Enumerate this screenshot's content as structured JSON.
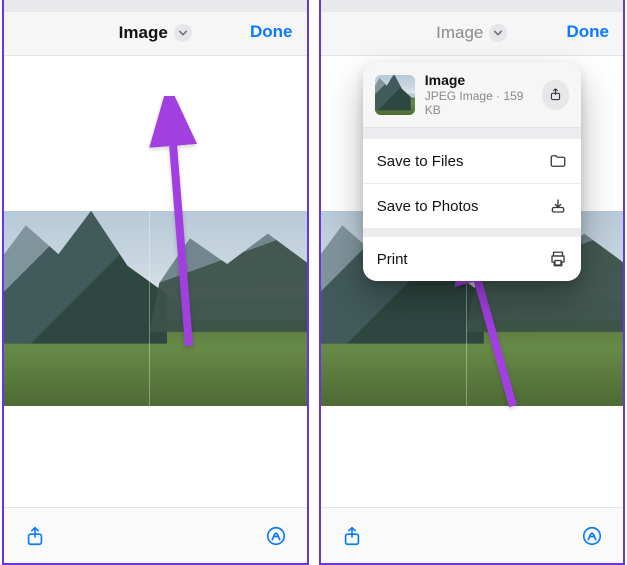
{
  "colors": {
    "accent": "#0a7aff",
    "annotation": "#a23fe0"
  },
  "left": {
    "header": {
      "title": "Image",
      "done_label": "Done"
    }
  },
  "right": {
    "header": {
      "title": "Image",
      "done_label": "Done"
    },
    "menu": {
      "file_name": "Image",
      "file_meta": "JPEG Image · 159 KB",
      "items": [
        {
          "label": "Save to Files",
          "icon": "folder-icon"
        },
        {
          "label": "Save to Photos",
          "icon": "download-tray-icon"
        }
      ],
      "print_label": "Print"
    }
  }
}
